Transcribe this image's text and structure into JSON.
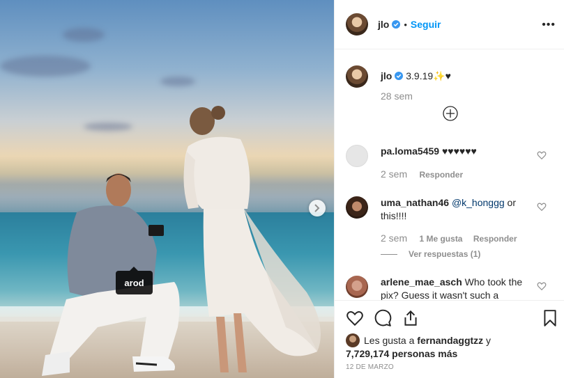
{
  "post": {
    "username": "jlo",
    "follow_label": "Seguir",
    "separator": "•",
    "more_label": "•••",
    "photo_tag": "arod",
    "caption_text": "3.9.19✨♥",
    "caption_time": "28 sem"
  },
  "comments": [
    {
      "user": "pa.loma5459",
      "text": " ♥♥♥♥♥♥",
      "time": "2 sem",
      "reply_label": "Responder"
    },
    {
      "user": "uma_nathan46",
      "mention": "@k_honggg",
      "text": " or this!!!!",
      "time": "2 sem",
      "likes_label": "1 Me gusta",
      "reply_label": "Responder",
      "view_replies": "Ver respuestas (1)"
    },
    {
      "user": "arlene_mae_asch",
      "text": " Who took the pix? Guess it wasn't such a"
    }
  ],
  "likes": {
    "prefix": "Les gusta a ",
    "user": "fernandaggtzz",
    "connector": " y",
    "count": "7,729,174 personas más"
  },
  "date": "12 DE MARZO",
  "icons": {
    "verified": "verified-badge-icon",
    "heart": "heart-icon",
    "comment": "comment-icon",
    "share": "share-icon",
    "save": "bookmark-icon",
    "load_more": "plus-circle-icon",
    "next": "chevron-right-icon"
  },
  "colors": {
    "accent": "#0095f6",
    "verified": "#3897f0",
    "text": "#262626",
    "muted": "#8e8e8e"
  }
}
